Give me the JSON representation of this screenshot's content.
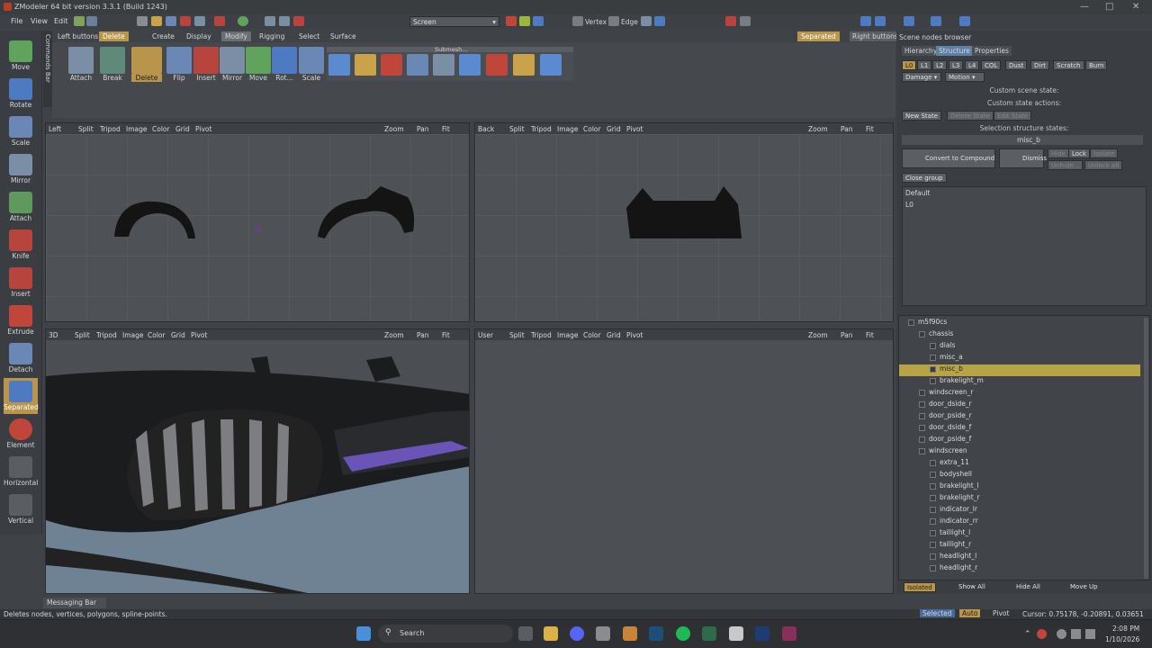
{
  "app": {
    "title": "ZModeler 64 bit version 3.3.1 (Build 1243)"
  },
  "menu": [
    "File",
    "View",
    "Edit"
  ],
  "toolbar": {
    "screen_combo": "Screen",
    "vertex": "Vertex",
    "edge": "Edge"
  },
  "left_tools": [
    {
      "name": "move",
      "label": "Move"
    },
    {
      "name": "rotate",
      "label": "Rotate"
    },
    {
      "name": "scale",
      "label": "Scale"
    },
    {
      "name": "mirror",
      "label": "Mirror"
    },
    {
      "name": "attach",
      "label": "Attach"
    },
    {
      "name": "knife",
      "label": "Knife"
    },
    {
      "name": "insert",
      "label": "Insert"
    },
    {
      "name": "extrude",
      "label": "Extrude"
    },
    {
      "name": "detach",
      "label": "Detach"
    },
    {
      "name": "separated",
      "label": "Separated",
      "active": true
    },
    {
      "name": "element",
      "label": "Element"
    },
    {
      "name": "horizontal",
      "label": "Horizontal"
    },
    {
      "name": "vertical",
      "label": "Vertical"
    }
  ],
  "commands_bar": "Commands Bar",
  "left_buttons_label": "Left buttons",
  "delete_tab": "Delete",
  "tabs": [
    "Create",
    "Display",
    "Modify",
    "Rigging",
    "Select",
    "Surface"
  ],
  "active_tab": "Modify",
  "ribbon": {
    "buttons": [
      "Attach",
      "Break",
      "Delete",
      "Flip",
      "Insert",
      "Mirror",
      "Move",
      "Rot...",
      "Scale"
    ],
    "submesh_label": "Submesh..."
  },
  "right_header": {
    "separated": "Separated",
    "right_buttons": "Right buttons"
  },
  "viewports": [
    {
      "name": "left",
      "label": "Left"
    },
    {
      "name": "back",
      "label": "Back"
    },
    {
      "name": "3d",
      "label": "3D"
    },
    {
      "name": "user",
      "label": "User"
    }
  ],
  "viewport_menu": [
    "Split",
    "Tripod",
    "Image",
    "Color",
    "Grid",
    "Pivot"
  ],
  "viewport_nav": [
    "Zoom",
    "Pan",
    "Fit"
  ],
  "scene_browser": {
    "title": "Scene nodes browser",
    "tabs": [
      "Hierarchy",
      "Structure",
      "Properties"
    ],
    "states": [
      "L0",
      "L1",
      "L2",
      "L3",
      "L4",
      "COL",
      "Dust",
      "Dirt",
      "Scratch",
      "Burn"
    ],
    "damage": "Damage",
    "motion": "Motion",
    "custom_scene_state": "Custom scene state:",
    "custom_state_actions": "Custom state actions:",
    "new_state": "New State",
    "delete_state": "Delete State",
    "edit_state": "Edit State",
    "selection_states": "Selection structure states:",
    "selected_node": "misc_b",
    "convert": "Convert to Compound",
    "dismiss": "Dismiss",
    "hide": "Hide",
    "lock": "Lock",
    "isolate": "Isolate",
    "unhide": "Unhide...",
    "unlock": "Unlock all",
    "close_group": "Close group",
    "list": [
      "Default",
      "L0"
    ]
  },
  "tree": [
    {
      "label": "m5f90cs",
      "level": 0
    },
    {
      "label": "chassis",
      "level": 1
    },
    {
      "label": "dials",
      "level": 2
    },
    {
      "label": "misc_a",
      "level": 2
    },
    {
      "label": "misc_b",
      "level": 2,
      "selected": true
    },
    {
      "label": "brakelight_m",
      "level": 2
    },
    {
      "label": "windscreen_r",
      "level": 2
    },
    {
      "label": "door_dside_r",
      "level": 2
    },
    {
      "label": "door_pside_r",
      "level": 2
    },
    {
      "label": "door_dside_f",
      "level": 2
    },
    {
      "label": "door_pside_f",
      "level": 2
    },
    {
      "label": "windscreen",
      "level": 2
    },
    {
      "label": "extra_11",
      "level": 2
    },
    {
      "label": "bodyshell",
      "level": 2
    },
    {
      "label": "brakelight_l",
      "level": 2
    },
    {
      "label": "brakelight_r",
      "level": 2
    },
    {
      "label": "indicator_lr",
      "level": 2
    },
    {
      "label": "indicator_rr",
      "level": 2
    },
    {
      "label": "taillight_l",
      "level": 2
    },
    {
      "label": "taillight_r",
      "level": 2
    },
    {
      "label": "headlight_l",
      "level": 2
    },
    {
      "label": "headlight_r",
      "level": 2
    }
  ],
  "tree_bottom": {
    "isolated": "Isolated",
    "show_all": "Show All",
    "hide_all": "Hide All",
    "move_up": "Move Up"
  },
  "messaging_bar": "Messaging Bar",
  "status": {
    "hint": "Deletes nodes, vertices, polygons, spline-points.",
    "selected": "Selected",
    "auto": "Auto",
    "pivot": "Pivot",
    "cursor": "Cursor: 0.75178, -0.20891, 0.03651"
  },
  "taskbar": {
    "search": "Search",
    "time": "2:08 PM",
    "date": "1/10/2026"
  }
}
